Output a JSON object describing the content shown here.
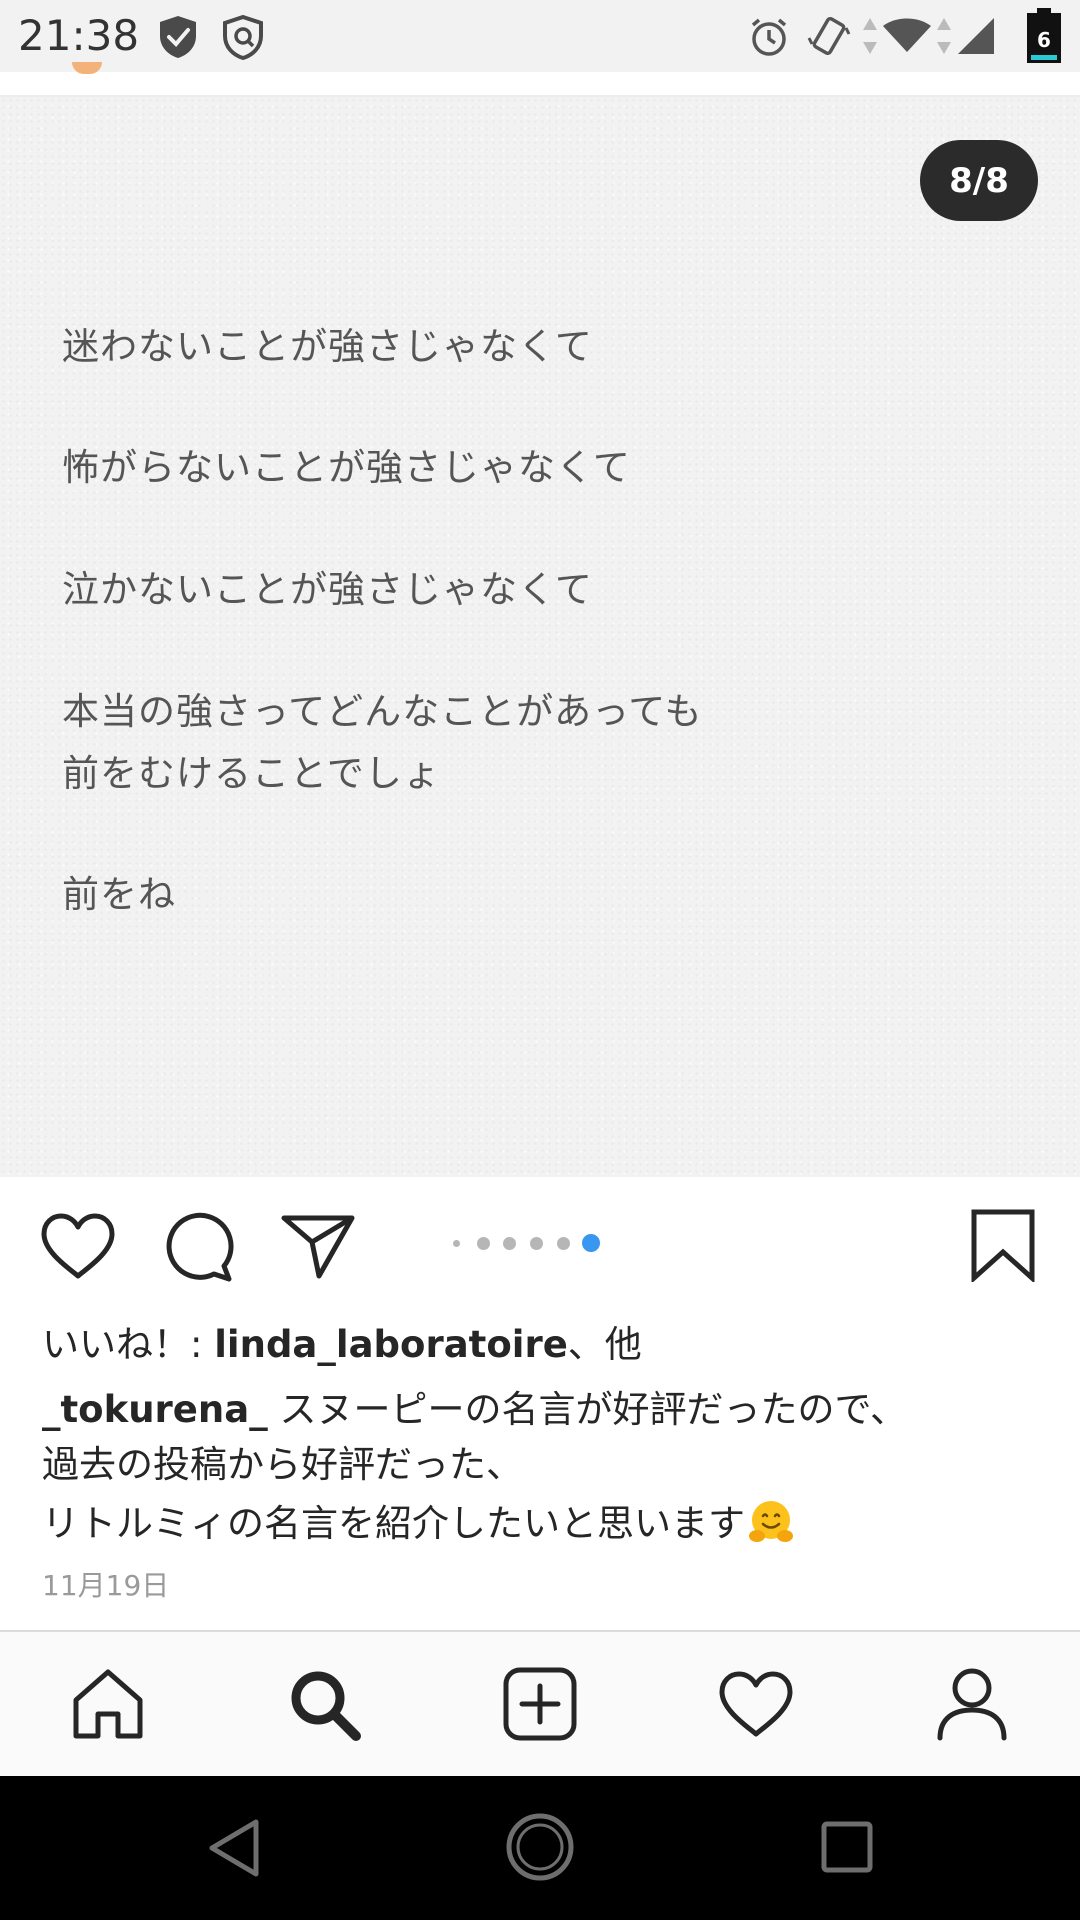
{
  "status_bar": {
    "time": "21:38",
    "battery_level": "6",
    "icons": [
      "shield-check-icon",
      "shield-icon",
      "alarm-icon",
      "vibrate-icon",
      "data-arrows-icon",
      "wifi-icon",
      "cellular-icon",
      "battery-icon"
    ]
  },
  "post": {
    "page_counter": "8/8",
    "carousel": {
      "total": 6,
      "active_index": 5
    },
    "quote_lines": [
      "迷わないことが強さじゃなくて",
      "怖がらないことが強さじゃなくて",
      "泣かないことが強さじゃなくて",
      "本当の強さってどんなことがあっても",
      "前をむけることでしょ",
      "前をね"
    ],
    "likes_prefix": "いいね！: ",
    "likes_user": "linda_laboratoire",
    "likes_suffix": "、他",
    "caption_user": "_tokurena_",
    "caption_lines": [
      " スヌーピーの名言が好評だったので、",
      "過去の投稿から好評だった、",
      "リトルミィの名言を紹介したいと思います"
    ],
    "caption_emoji": "hugging-face-emoji",
    "date": "11月19日"
  },
  "action_bar": {
    "icons": [
      "heart-icon",
      "comment-icon",
      "share-icon",
      "bookmark-icon"
    ]
  },
  "bottom_nav": {
    "items": [
      "home-icon",
      "search-icon",
      "add-post-icon",
      "activity-heart-icon",
      "profile-icon"
    ],
    "active": "search-icon"
  },
  "system_nav": {
    "items": [
      "back-icon",
      "home-circle-icon",
      "recents-icon"
    ]
  },
  "colors": {
    "carousel_active_dot": "#3897f0",
    "page_counter_bg": "#2b2b2b",
    "system_nav_bg": "#000000"
  }
}
